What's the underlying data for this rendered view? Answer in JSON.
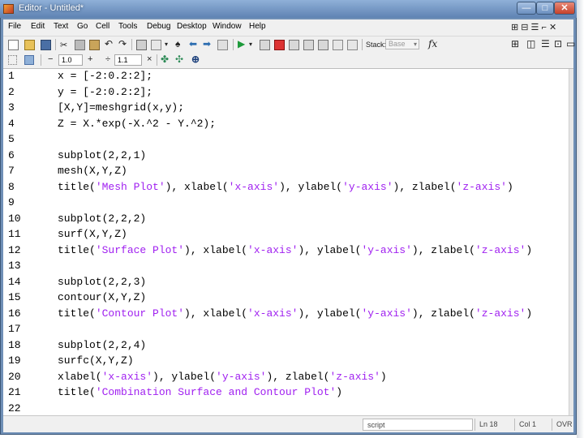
{
  "window": {
    "title": "Editor - Untitled*",
    "minimize": "—",
    "maximize": "□",
    "close": "✕"
  },
  "menu": {
    "items": [
      "File",
      "Edit",
      "Text",
      "Go",
      "Cell",
      "Tools",
      "Debug",
      "Desktop",
      "Window",
      "Help"
    ],
    "dock_icons": "⊞ ⊟ ☰ ⌐ ✕"
  },
  "toolbar": {
    "stack_label": "Stack:",
    "stack_value": "Base",
    "fx_label": "fx",
    "cell_step_value": "1.0",
    "cell_divisor_value": "1.1",
    "minus": "−",
    "plus": "+",
    "divide": "÷",
    "times": "×"
  },
  "editor": {
    "line_numbers": [
      "1",
      "2",
      "3",
      "4",
      "5",
      "6",
      "7",
      "8",
      "9",
      "10",
      "11",
      "12",
      "13",
      "14",
      "15",
      "16",
      "17",
      "18",
      "19",
      "20",
      "21",
      "22"
    ],
    "lines": [
      [
        {
          "t": "x = [-2:0.2:2];"
        }
      ],
      [
        {
          "t": "y = [-2:0.2:2];"
        }
      ],
      [
        {
          "t": "[X,Y]=meshgrid(x,y);"
        }
      ],
      [
        {
          "t": "Z = X.*exp(-X.^2 - Y.^2);"
        }
      ],
      [],
      [
        {
          "t": "subplot(2,2,1)"
        }
      ],
      [
        {
          "t": "mesh(X,Y,Z)"
        }
      ],
      [
        {
          "t": "title("
        },
        {
          "t": "'Mesh Plot'",
          "s": true
        },
        {
          "t": "), xlabel("
        },
        {
          "t": "'x-axis'",
          "s": true
        },
        {
          "t": "), ylabel("
        },
        {
          "t": "'y-axis'",
          "s": true
        },
        {
          "t": "), zlabel("
        },
        {
          "t": "'z-axis'",
          "s": true
        },
        {
          "t": ")"
        }
      ],
      [],
      [
        {
          "t": "subplot(2,2,2)"
        }
      ],
      [
        {
          "t": "surf(X,Y,Z)"
        }
      ],
      [
        {
          "t": "title("
        },
        {
          "t": "'Surface Plot'",
          "s": true
        },
        {
          "t": "), xlabel("
        },
        {
          "t": "'x-axis'",
          "s": true
        },
        {
          "t": "), ylabel("
        },
        {
          "t": "'y-axis'",
          "s": true
        },
        {
          "t": "), zlabel("
        },
        {
          "t": "'z-axis'",
          "s": true
        },
        {
          "t": ")"
        }
      ],
      [],
      [
        {
          "t": "subplot(2,2,3)"
        }
      ],
      [
        {
          "t": "contour(X,Y,Z)"
        }
      ],
      [
        {
          "t": "title("
        },
        {
          "t": "'Contour Plot'",
          "s": true
        },
        {
          "t": "), xlabel("
        },
        {
          "t": "'x-axis'",
          "s": true
        },
        {
          "t": "), ylabel("
        },
        {
          "t": "'y-axis'",
          "s": true
        },
        {
          "t": "), zlabel("
        },
        {
          "t": "'z-axis'",
          "s": true
        },
        {
          "t": ")"
        }
      ],
      [],
      [
        {
          "t": "subplot(2,2,4)"
        }
      ],
      [
        {
          "t": "surfc(X,Y,Z)"
        }
      ],
      [
        {
          "t": "xlabel("
        },
        {
          "t": "'x-axis'",
          "s": true
        },
        {
          "t": "), ylabel("
        },
        {
          "t": "'y-axis'",
          "s": true
        },
        {
          "t": "), zlabel("
        },
        {
          "t": "'z-axis'",
          "s": true
        },
        {
          "t": ")"
        }
      ],
      [
        {
          "t": "title("
        },
        {
          "t": "'Combination Surface and Contour Plot'",
          "s": true
        },
        {
          "t": ")"
        }
      ],
      []
    ]
  },
  "status": {
    "mode": "script",
    "line": "Ln 18",
    "col": "Col 1",
    "ovr": "OVR"
  },
  "colors": {
    "string": "#a020f0",
    "title_bar": "#6f8fb6"
  }
}
